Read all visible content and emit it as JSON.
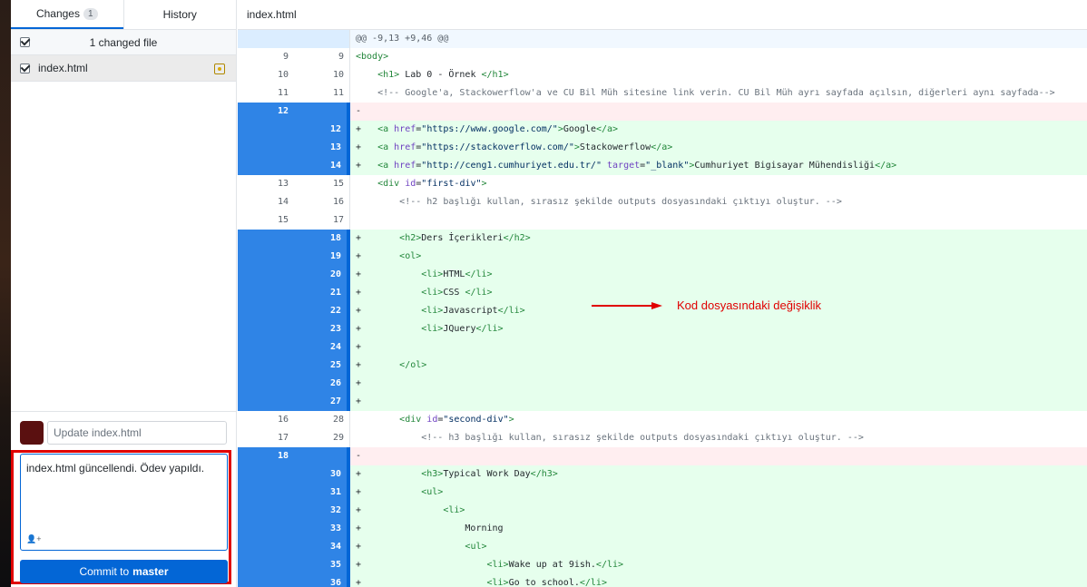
{
  "tabs": {
    "changes": "Changes",
    "changes_count": "1",
    "history": "History"
  },
  "file_list": {
    "select_all_label": "1 changed file",
    "files": [
      {
        "name": "index.html"
      }
    ]
  },
  "commit": {
    "summary_placeholder": "Update index.html",
    "description": "index.html güncellendi. Ödev yapıldı.",
    "button_prefix": "Commit to",
    "branch": "master"
  },
  "diff": {
    "filename": "index.html",
    "hunk_header": "@@ -9,13 +9,46 @@",
    "annotation": "Kod dosyasındaki değişiklik"
  },
  "colors": {
    "accent": "#0366d6",
    "annotation_red": "#e00000",
    "added_bg": "#e6ffed",
    "removed_bg": "#ffeef0"
  }
}
